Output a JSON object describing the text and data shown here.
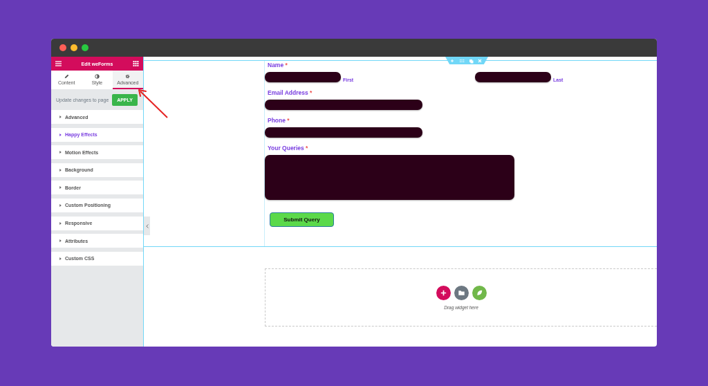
{
  "sidebar": {
    "title": "Edit weForms",
    "tabs": [
      {
        "label": "Content",
        "selected": false,
        "kind": "pencil"
      },
      {
        "label": "Style",
        "selected": false,
        "kind": "contrast"
      },
      {
        "label": "Advanced",
        "selected": true,
        "kind": "gear"
      }
    ],
    "apply_text": "Update changes to page",
    "apply_button": "APPLY",
    "sections": [
      {
        "label": "Advanced",
        "highlighted": false
      },
      {
        "label": "Happy Effects",
        "highlighted": true
      },
      {
        "label": "Motion Effects",
        "highlighted": false
      },
      {
        "label": "Background",
        "highlighted": false
      },
      {
        "label": "Border",
        "highlighted": false
      },
      {
        "label": "Custom Positioning",
        "highlighted": false
      },
      {
        "label": "Responsive",
        "highlighted": false
      },
      {
        "label": "Attributes",
        "highlighted": false
      },
      {
        "label": "Custom CSS",
        "highlighted": false
      }
    ]
  },
  "form": {
    "fields": [
      {
        "kind": "name",
        "label": "Name",
        "required_mark": "*",
        "sublabels": [
          "First",
          "Last"
        ]
      },
      {
        "kind": "input",
        "label": "Email Address",
        "required_mark": "*"
      },
      {
        "kind": "input",
        "label": "Phone",
        "required_mark": "*"
      },
      {
        "kind": "textarea",
        "label": "Your Queries",
        "required_mark": "*"
      }
    ],
    "submit": "Submit Query"
  },
  "drop_zone": {
    "text": "Drag widget here"
  }
}
